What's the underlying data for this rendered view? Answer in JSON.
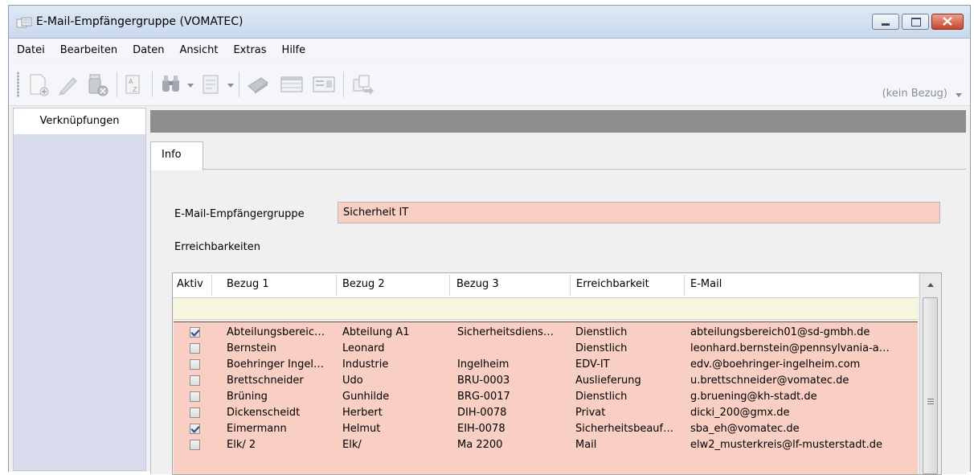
{
  "window": {
    "title": "E-Mail-Empfängergruppe (VOMATEC)"
  },
  "menu": [
    "Datei",
    "Bearbeiten",
    "Daten",
    "Ansicht",
    "Extras",
    "Hilfe"
  ],
  "toolbar": {
    "bezug_select": "(kein Bezug)"
  },
  "left_panel": {
    "tab_label": "Verknüpfungen"
  },
  "tabs": {
    "info": "Info"
  },
  "form": {
    "group_label": "E-Mail-Empfängergruppe",
    "group_value": "Sicherheit IT",
    "reach_label": "Erreichbarkeiten"
  },
  "grid": {
    "columns": [
      "Aktiv",
      "Bezug 1",
      "Bezug 2",
      "Bezug 3",
      "Erreichbarkeit",
      "E-Mail"
    ],
    "rows": [
      {
        "aktiv": true,
        "b1": "Abteilungsbereic…",
        "b2": "Abteilung A1",
        "b3": "Sicherheitsdiens…",
        "er": "Dienstlich",
        "mail": "abteilungsbereich01@sd-gmbh.de"
      },
      {
        "aktiv": false,
        "b1": "Bernstein",
        "b2": "Leonard",
        "b3": "",
        "er": "Dienstlich",
        "mail": "leonhard.bernstein@pennsylvania-a…"
      },
      {
        "aktiv": false,
        "b1": "Boehringer Ingel…",
        "b2": "Industrie",
        "b3": "Ingelheim",
        "er": "EDV-IT",
        "mail": "edv.@boehringer-ingelheim.com"
      },
      {
        "aktiv": false,
        "b1": "Brettschneider",
        "b2": "Udo",
        "b3": "BRU-0003",
        "er": "Auslieferung",
        "mail": "u.brettschneider@vomatec.de"
      },
      {
        "aktiv": false,
        "b1": "Brüning",
        "b2": "Gunhilde",
        "b3": "BRG-0017",
        "er": "Dienstlich",
        "mail": "g.bruening@kh-stadt.de"
      },
      {
        "aktiv": false,
        "b1": "Dickenscheidt",
        "b2": "Herbert",
        "b3": "DIH-0078",
        "er": "Privat",
        "mail": "dicki_200@gmx.de"
      },
      {
        "aktiv": true,
        "b1": "Eimermann",
        "b2": "Helmut",
        "b3": "EIH-0078",
        "er": "Sicherheitsbeauf…",
        "mail": "sba_eh@vomatec.de"
      },
      {
        "aktiv": false,
        "b1": "Elk/ 2",
        "b2": "Elk/",
        "b3": "Ma 2200",
        "er": "Mail",
        "mail": "elw2_musterkreis@lf-musterstadt.de"
      }
    ]
  }
}
